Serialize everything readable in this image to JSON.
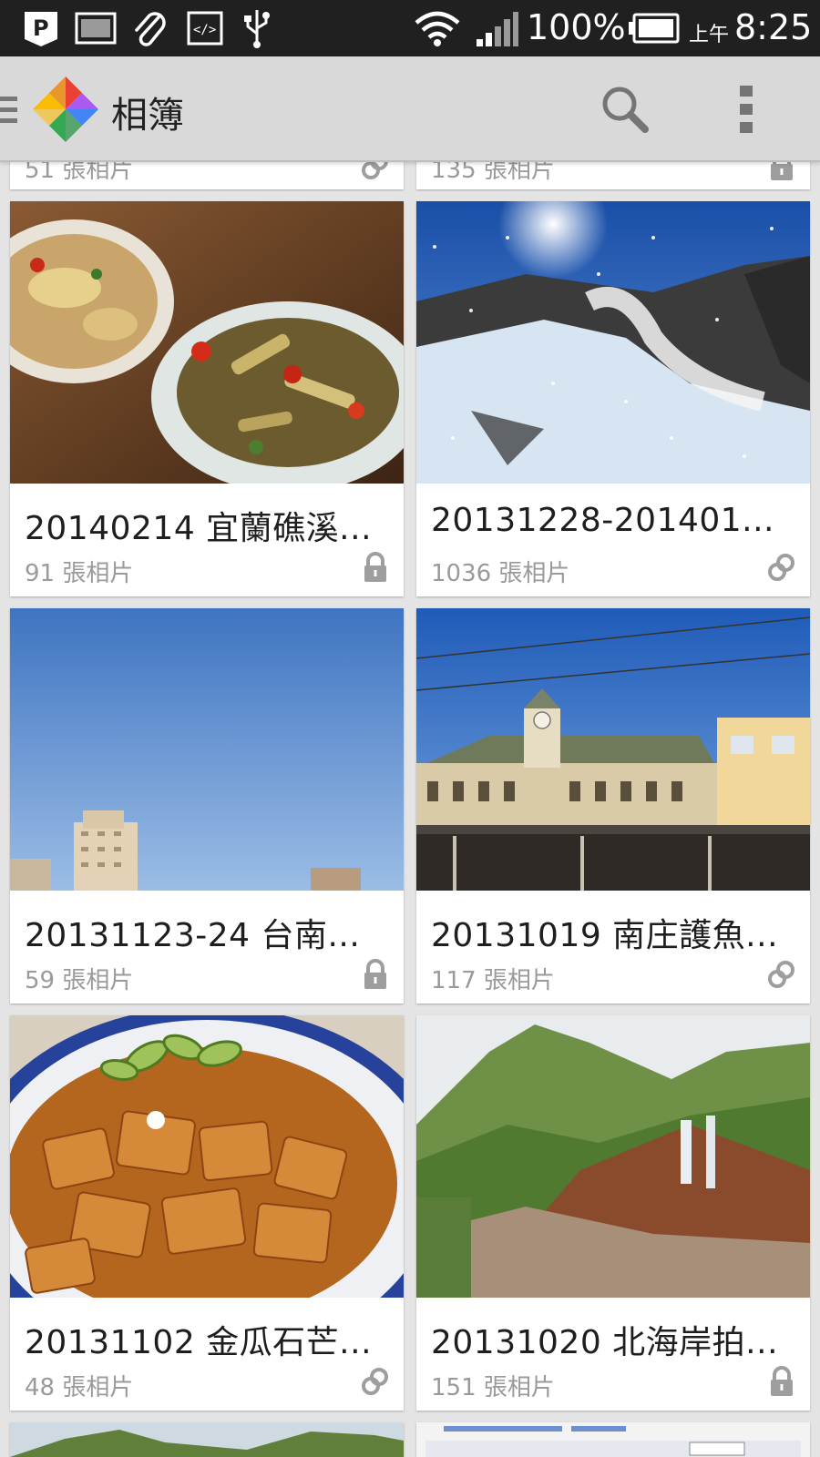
{
  "status_bar": {
    "battery": "100%",
    "ampm": "上午",
    "time": "8:25"
  },
  "app_bar": {
    "title": "相簿",
    "icons": [
      "menu-icon",
      "photos-logo",
      "search-icon",
      "overflow-menu-icon"
    ]
  },
  "partial_top": [
    {
      "count": "51 張相片",
      "status": "shared"
    },
    {
      "count": "135 張相片",
      "status": "private"
    }
  ],
  "albums": [
    {
      "title": "20140214 宜蘭礁溪...",
      "count": "91 張相片",
      "status": "private",
      "thumb": "food-dishes"
    },
    {
      "title": "20131228-201401...",
      "count": "1036 張相片",
      "status": "shared",
      "thumb": "snowy-volcano"
    },
    {
      "title": "20131123-24 台南...",
      "count": "59 張相片",
      "status": "private",
      "thumb": "blue-sky-buildings"
    },
    {
      "title": "20131019 南庄護魚...",
      "count": "117 張相片",
      "status": "shared",
      "thumb": "station-building"
    },
    {
      "title": "20131102 金瓜石芒...",
      "count": "48 張相片",
      "status": "shared",
      "thumb": "fried-tofu"
    },
    {
      "title": "20131020 北海岸拍...",
      "count": "151 張相片",
      "status": "private",
      "thumb": "waterfall-hills"
    }
  ],
  "colors": {
    "status_bar_bg": "#202020",
    "app_bar_bg": "#d9d9d9",
    "background": "#e4e4e4",
    "card_bg": "#ffffff",
    "title_text": "#1e1e1e",
    "count_text": "#9a9a9a"
  }
}
